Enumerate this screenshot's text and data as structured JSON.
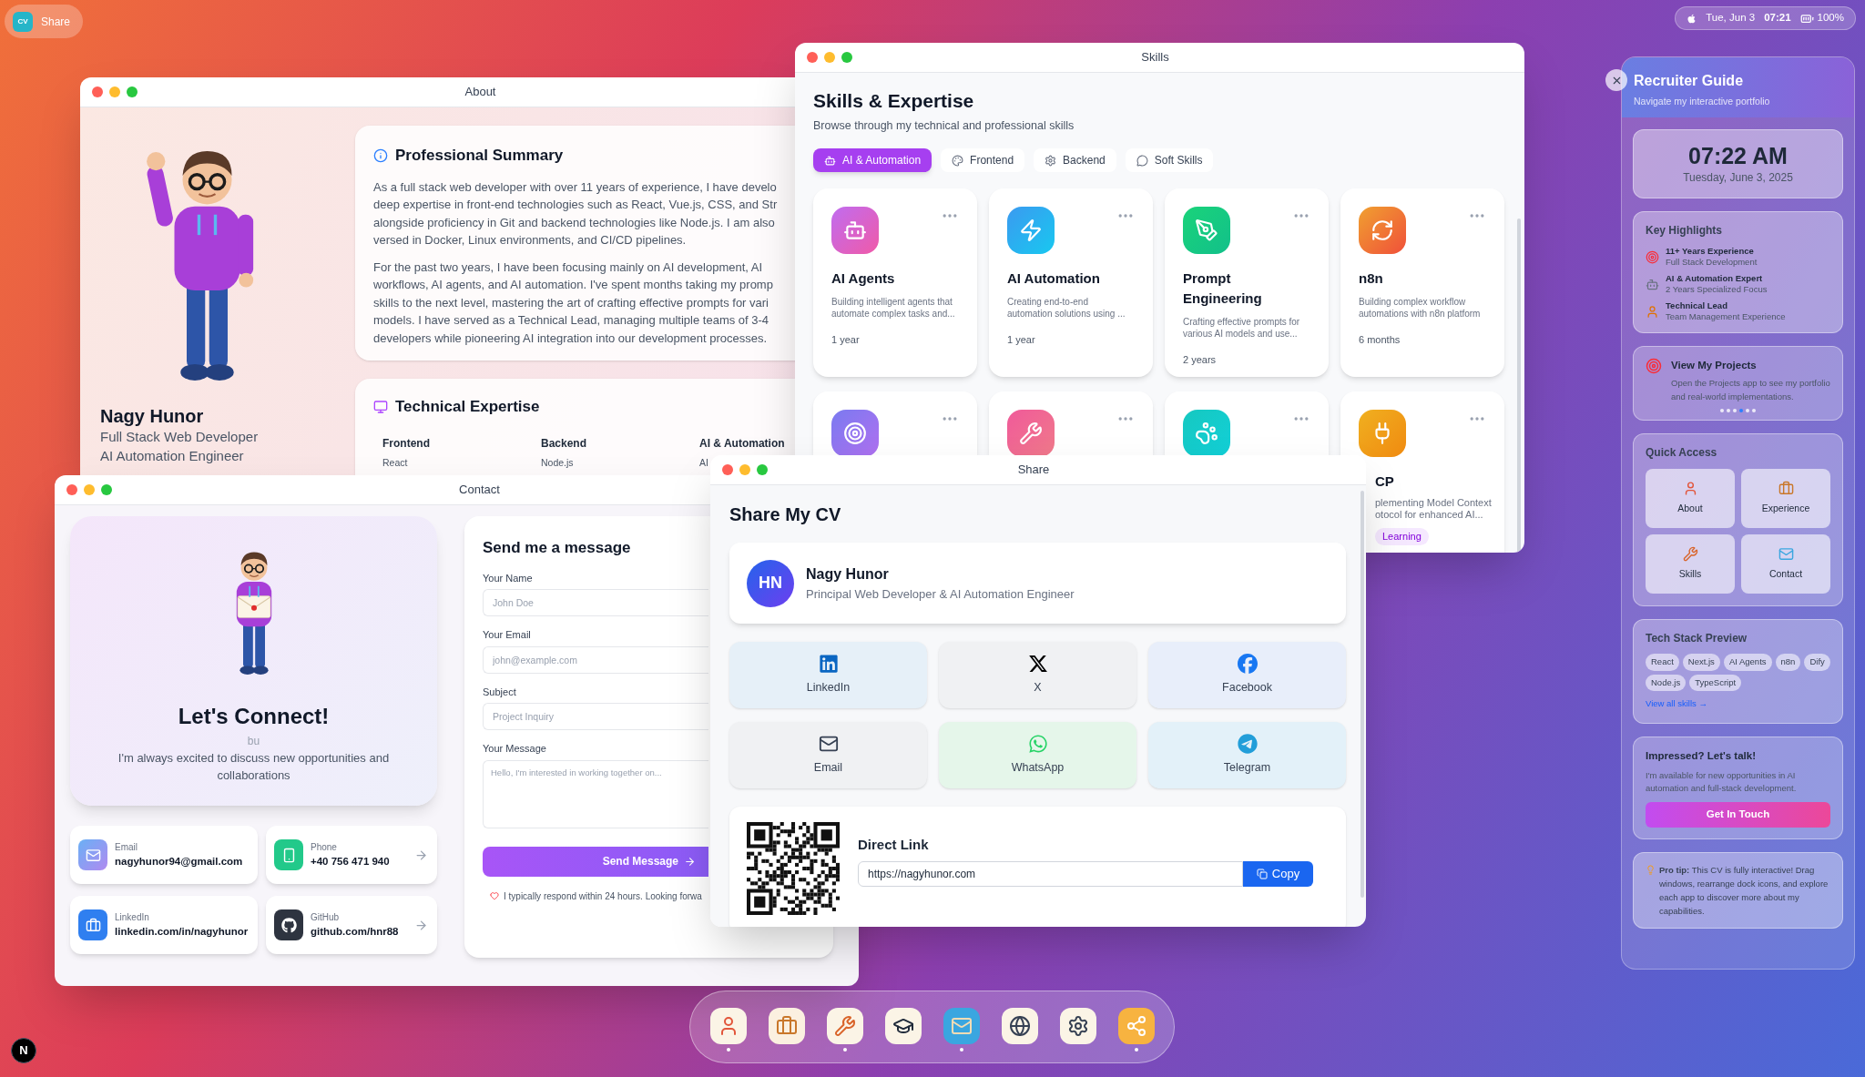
{
  "menu_bar": {
    "app_icon": "CV",
    "app_name": "Share"
  },
  "status": {
    "date": "Tue, Jun 3",
    "time": "07:21",
    "battery": "100%"
  },
  "about": {
    "title": "About",
    "name": "Nagy Hunor",
    "roles": [
      "Full Stack Web Developer",
      "AI Automation Engineer"
    ],
    "summary": {
      "heading": "Professional Summary",
      "paragraphs": [
        [
          "As a full stack web developer with over 11 years of experience, I have develo",
          "deep expertise in front-end technologies such as React, Vue.js, CSS, and Str",
          "alongside proficiency in Git and backend technologies like Node.js. I am also",
          "versed in Docker, Linux environments, and CI/CD pipelines."
        ],
        [
          "For the past two years, I have been focusing mainly on AI development, AI",
          "workflows, AI agents, and AI automation. I've spent months taking my promp",
          "skills to the next level, mastering the art of crafting effective prompts for vari",
          "models. I have served as a Technical Lead, managing multiple teams of 3-4",
          "developers while pioneering AI integration into our development processes."
        ]
      ]
    },
    "expertise": {
      "heading": "Technical Expertise",
      "columns": [
        {
          "heading": "Frontend",
          "items": [
            "React"
          ]
        },
        {
          "heading": "Backend",
          "items": [
            "Node.js"
          ]
        },
        {
          "heading": "AI & Automation",
          "items": [
            "AI"
          ]
        }
      ]
    }
  },
  "skills": {
    "title": "Skills",
    "heading": "Skills & Expertise",
    "subtitle": "Browse through my technical and professional skills",
    "tabs": [
      {
        "label": "AI & Automation",
        "kind": "robot",
        "selected": true
      },
      {
        "label": "Frontend",
        "kind": "palette",
        "selected": false
      },
      {
        "label": "Backend",
        "kind": "gear",
        "selected": false
      },
      {
        "label": "Soft Skills",
        "kind": "chat",
        "selected": false
      }
    ],
    "cards": [
      {
        "kind": "robot",
        "title": "AI Agents",
        "description": "Building intelligent agents that automate complex tasks and...",
        "duration": "1 year"
      },
      {
        "kind": "bolt",
        "title": "AI Automation",
        "description": "Creating end-to-end automation solutions using ...",
        "duration": "1 year"
      },
      {
        "kind": "pen",
        "title": "Prompt Engineering",
        "description": "Crafting effective prompts for various AI models and use...",
        "duration": "2 years"
      },
      {
        "kind": "cycle",
        "title": "n8n",
        "description": "Building complex workflow automations with n8n platform",
        "duration": "6 months"
      }
    ],
    "more_cards": [
      {
        "kind": "target"
      },
      {
        "kind": "wrench"
      },
      {
        "kind": "llama"
      },
      {
        "kind": "plug",
        "title": "CP",
        "description": [
          "plementing Model Context",
          "otocol for enhanced AI..."
        ],
        "badge": "Learning"
      }
    ]
  },
  "contact": {
    "title": "Contact",
    "heading": "Let's Connect!",
    "faint_text": "bu",
    "description": "I'm always excited to discuss new opportunities and collaborations",
    "items": [
      {
        "kind": "email",
        "label": "Email",
        "value": "nagyhunor94@gmail.com",
        "arrow": false
      },
      {
        "kind": "phone",
        "label": "Phone",
        "value": "+40 756 471 940",
        "arrow": true
      },
      {
        "kind": "linkedin",
        "label": "LinkedIn",
        "value": "linkedin.com/in/nagyhunor",
        "arrow": false
      },
      {
        "kind": "github",
        "label": "GitHub",
        "value": "github.com/hnr88",
        "arrow": true
      }
    ],
    "form": {
      "heading": "Send me a message",
      "fields": [
        {
          "kind": "input",
          "label": "Your Name",
          "placeholder": "John Doe"
        },
        {
          "kind": "input",
          "label": "Your Email",
          "placeholder": "john@example.com"
        },
        {
          "kind": "input",
          "label": "Subject",
          "placeholder": "Project Inquiry"
        },
        {
          "kind": "textarea",
          "label": "Your Message",
          "placeholder": "Hello, I'm interested in working together on..."
        }
      ],
      "submit": "Send Message",
      "note": "I typically respond within 24 hours. Looking forwa"
    }
  },
  "share": {
    "title": "Share",
    "heading": "Share My CV",
    "profile": {
      "initials": "HN",
      "name": "Nagy Hunor",
      "role": "Principal Web Developer & AI Automation Engineer"
    },
    "buttons": [
      {
        "kind": "linkedin",
        "label": "LinkedIn"
      },
      {
        "kind": "x",
        "label": "X"
      },
      {
        "kind": "facebook",
        "label": "Facebook"
      },
      {
        "kind": "email",
        "label": "Email"
      },
      {
        "kind": "whatsapp",
        "label": "WhatsApp"
      },
      {
        "kind": "telegram",
        "label": "Telegram"
      }
    ],
    "direct_link": {
      "heading": "Direct Link",
      "url": "https://nagyhunor.com",
      "copy": "Copy"
    }
  },
  "guide": {
    "title": "Recruiter Guide",
    "subtitle": "Navigate my interactive portfolio",
    "clock": {
      "time": "07:22 AM",
      "date": "Tuesday, June 3, 2025"
    },
    "highlights": {
      "heading": "Key Highlights",
      "items": [
        {
          "kind": "target",
          "title": "11+ Years Experience",
          "detail": "Full Stack Development"
        },
        {
          "kind": "robot",
          "title": "AI & Automation Expert",
          "detail": "2 Years Specialized Focus"
        },
        {
          "kind": "person",
          "title": "Technical Lead",
          "detail": "Team Management Experience"
        }
      ]
    },
    "projects": {
      "title": "View My Projects",
      "text": "Open the Projects app to see my portfolio and real-world implementations.",
      "dots": [
        {
          "selected": false
        },
        {
          "selected": false
        },
        {
          "selected": false
        },
        {
          "selected": true
        },
        {
          "selected": false
        },
        {
          "selected": false
        }
      ]
    },
    "quick_access": {
      "heading": "Quick Access",
      "items": [
        {
          "kind": "about",
          "label": "About"
        },
        {
          "kind": "experience",
          "label": "Experience"
        },
        {
          "kind": "skills",
          "label": "Skills"
        },
        {
          "kind": "contact",
          "label": "Contact"
        }
      ]
    },
    "tech_stack": {
      "heading": "Tech Stack Preview",
      "chips": [
        "React",
        "Next.js",
        "AI Agents",
        "n8n",
        "Dify",
        "Node.js",
        "TypeScript"
      ],
      "link": "View all skills →"
    },
    "cta": {
      "heading": "Impressed? Let's talk!",
      "text": "I'm available for new opportunities in AI automation and full-stack development.",
      "button": "Get In Touch"
    },
    "tip": "**Pro tip:** This CV is fully interactive! Drag windows, rearrange dock icons, and explore each app to discover more about my capabilities."
  },
  "dock": [
    {
      "kind": "about",
      "running": true
    },
    {
      "kind": "experience",
      "running": false
    },
    {
      "kind": "skills",
      "running": true
    },
    {
      "kind": "education",
      "running": false
    },
    {
      "kind": "contact",
      "running": true
    },
    {
      "kind": "web",
      "running": false
    },
    {
      "kind": "settings",
      "running": false
    },
    {
      "kind": "share",
      "running": true
    }
  ],
  "dev_badge": "N"
}
